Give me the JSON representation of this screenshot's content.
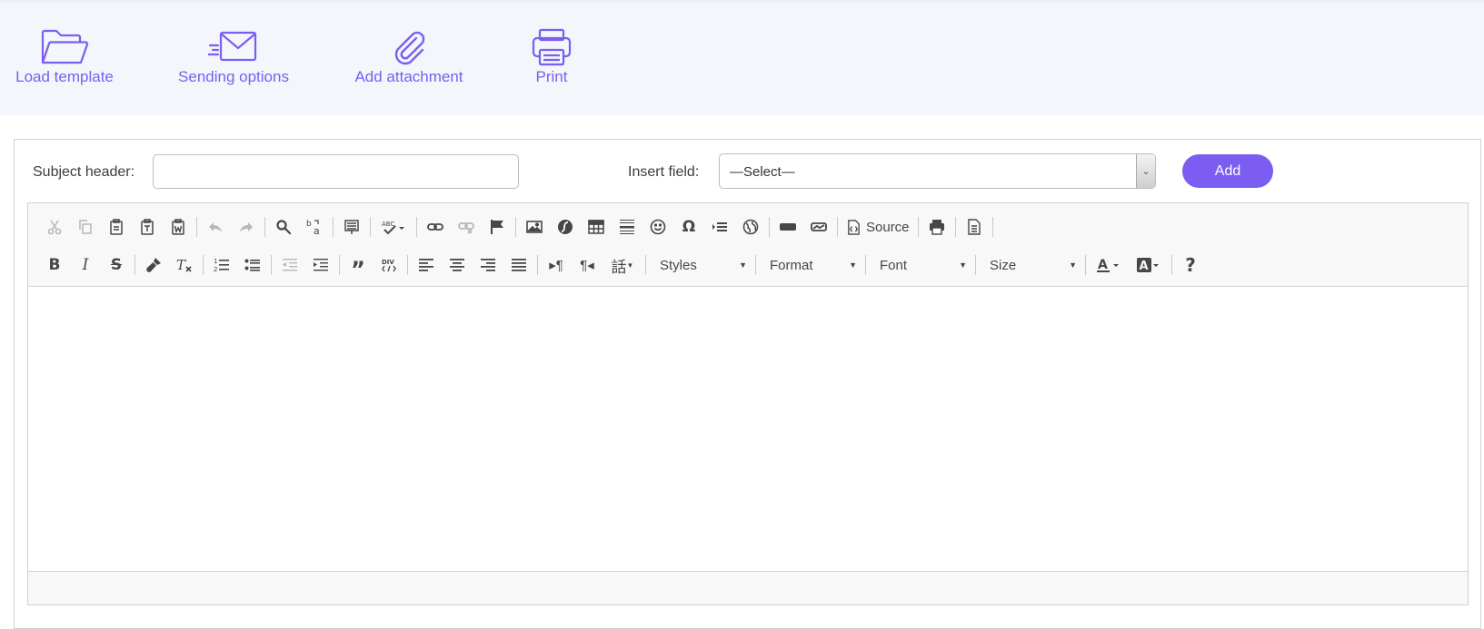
{
  "actions": [
    {
      "label": "Load template",
      "icon": "folder-open-icon"
    },
    {
      "label": "Sending options",
      "icon": "envelope-icon"
    },
    {
      "label": "Add attachment",
      "icon": "paperclip-icon"
    },
    {
      "label": "Print",
      "icon": "printer-icon"
    }
  ],
  "form": {
    "subject_label": "Subject header:",
    "subject_value": "",
    "insert_label": "Insert field:",
    "insert_value": "—Select—",
    "add_label": "Add"
  },
  "toolbar": {
    "source_label": "Source",
    "styles_label": "Styles",
    "format_label": "Format",
    "font_label": "Font",
    "size_label": "Size",
    "help_label": "?"
  },
  "colors": {
    "accent": "#7b5ef1",
    "topbar_bg": "#f3f6fa",
    "toolbar_bg": "#f8f8f8"
  }
}
